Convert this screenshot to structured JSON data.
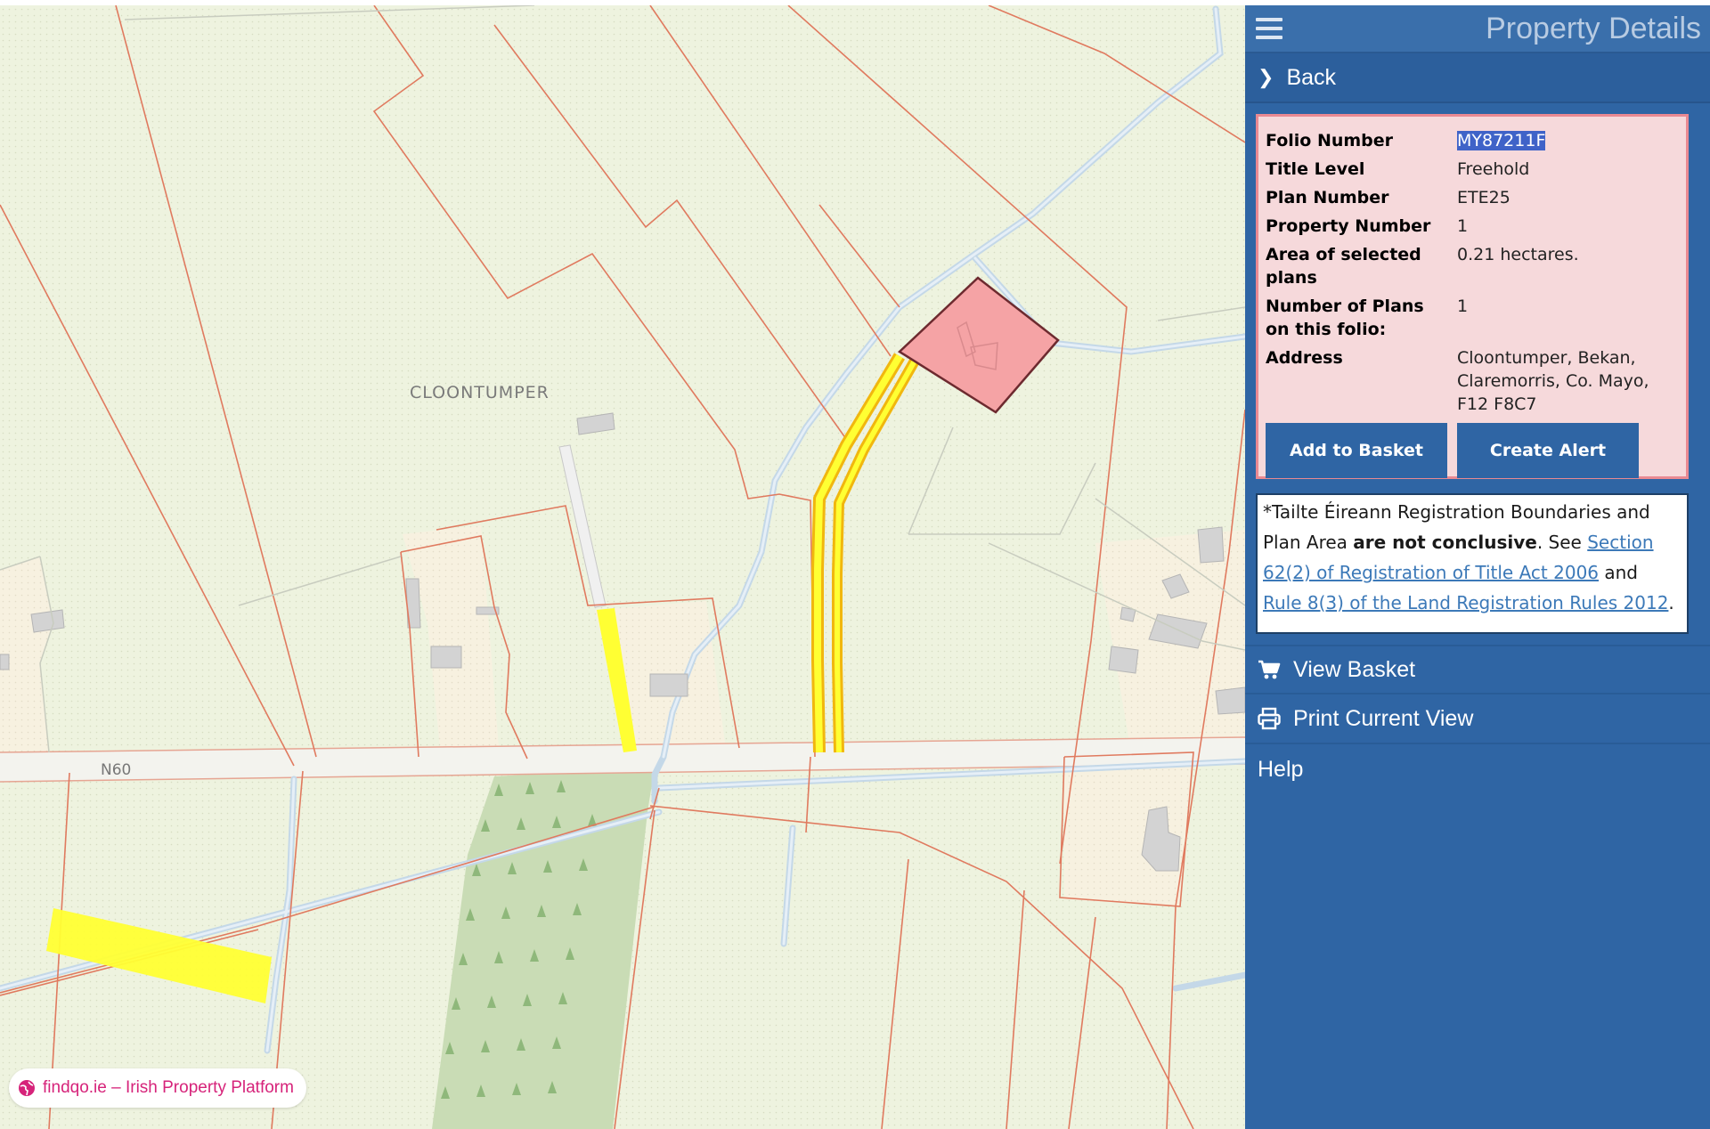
{
  "map": {
    "townland_label": "CLOONTUMPER",
    "road_label": "N60",
    "watermark": "findqo.ie – Irish Property Platform"
  },
  "panel": {
    "title": "Property Details",
    "menu_icon": "hamburger-icon",
    "back_label": "Back",
    "details": {
      "folio_number_label": "Folio Number",
      "folio_number": "MY87211F",
      "title_level_label": "Title Level",
      "title_level": "Freehold",
      "plan_number_label": "Plan Number",
      "plan_number": "ETE25",
      "property_number_label": "Property Number",
      "property_number": "1",
      "area_label": "Area of selected plans",
      "area": "0.21 hectares.",
      "num_plans_label": "Number of Plans on this folio:",
      "num_plans": "1",
      "address_label": "Address",
      "address": "Cloontumper, Bekan, Claremorris, Co. Mayo, F12 F8C7"
    },
    "buttons": {
      "add_to_basket": "Add to Basket",
      "create_alert": "Create Alert"
    },
    "disclaimer": {
      "prefix": "*Tailte Éireann Registration Boundaries and Plan Area ",
      "bold": "are not conclusive",
      "mid": ". See ",
      "link1": "Section 62(2) of Registration of Title Act 2006",
      "and": " and ",
      "link2": "Rule 8(3) of the Land Registration Rules 2012",
      "suffix": "."
    },
    "menu": {
      "view_basket": "View Basket",
      "print_view": "Print Current View",
      "help": "Help"
    }
  },
  "colors": {
    "panel_bg": "#2f65a4",
    "details_bg": "#f6d9db",
    "map_bg": "#eef3df",
    "boundary": "#e07a5f",
    "selected_plot": "#f5a3a5",
    "highlight_yellow": "#ffff33",
    "forest": "#c9dcb5",
    "watermark": "#d6237a"
  }
}
